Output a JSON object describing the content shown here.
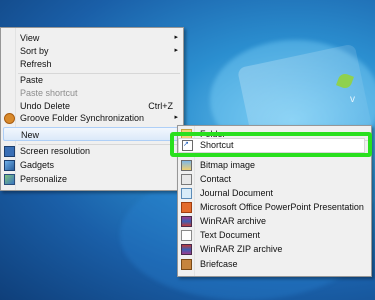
{
  "main_menu": {
    "view_label": "View",
    "sort_by_label": "Sort by",
    "refresh_label": "Refresh",
    "paste_label": "Paste",
    "paste_shortcut_label": "Paste shortcut",
    "undo_delete_label": "Undo Delete",
    "undo_delete_accel": "Ctrl+Z",
    "groove_label": "Groove Folder Synchronization",
    "new_label": "New",
    "screen_resolution_label": "Screen resolution",
    "gadgets_label": "Gadgets",
    "personalize_label": "Personalize",
    "submenu_arrow": "▸"
  },
  "new_submenu": {
    "folder_label": "Folder",
    "shortcut_label": "Shortcut",
    "bitmap_label": "Bitmap image",
    "contact_label": "Contact",
    "journal_label": "Journal Document",
    "powerpoint_label": "Microsoft Office PowerPoint Presentation",
    "winrar_label": "WinRAR archive",
    "text_label": "Text Document",
    "winrar_zip_label": "WinRAR ZIP archive",
    "briefcase_label": "Briefcase"
  },
  "colors": {
    "highlight": "#29e01e",
    "desktop_blue": "#1a5fa8"
  },
  "icons": [
    "groove-icon",
    "screen-resolution-icon",
    "gadgets-icon",
    "personalize-icon",
    "folder-icon",
    "shortcut-icon",
    "bitmap-icon",
    "contact-icon",
    "journal-icon",
    "powerpoint-icon",
    "winrar-icon",
    "text-document-icon",
    "winrar-zip-icon",
    "briefcase-icon"
  ]
}
